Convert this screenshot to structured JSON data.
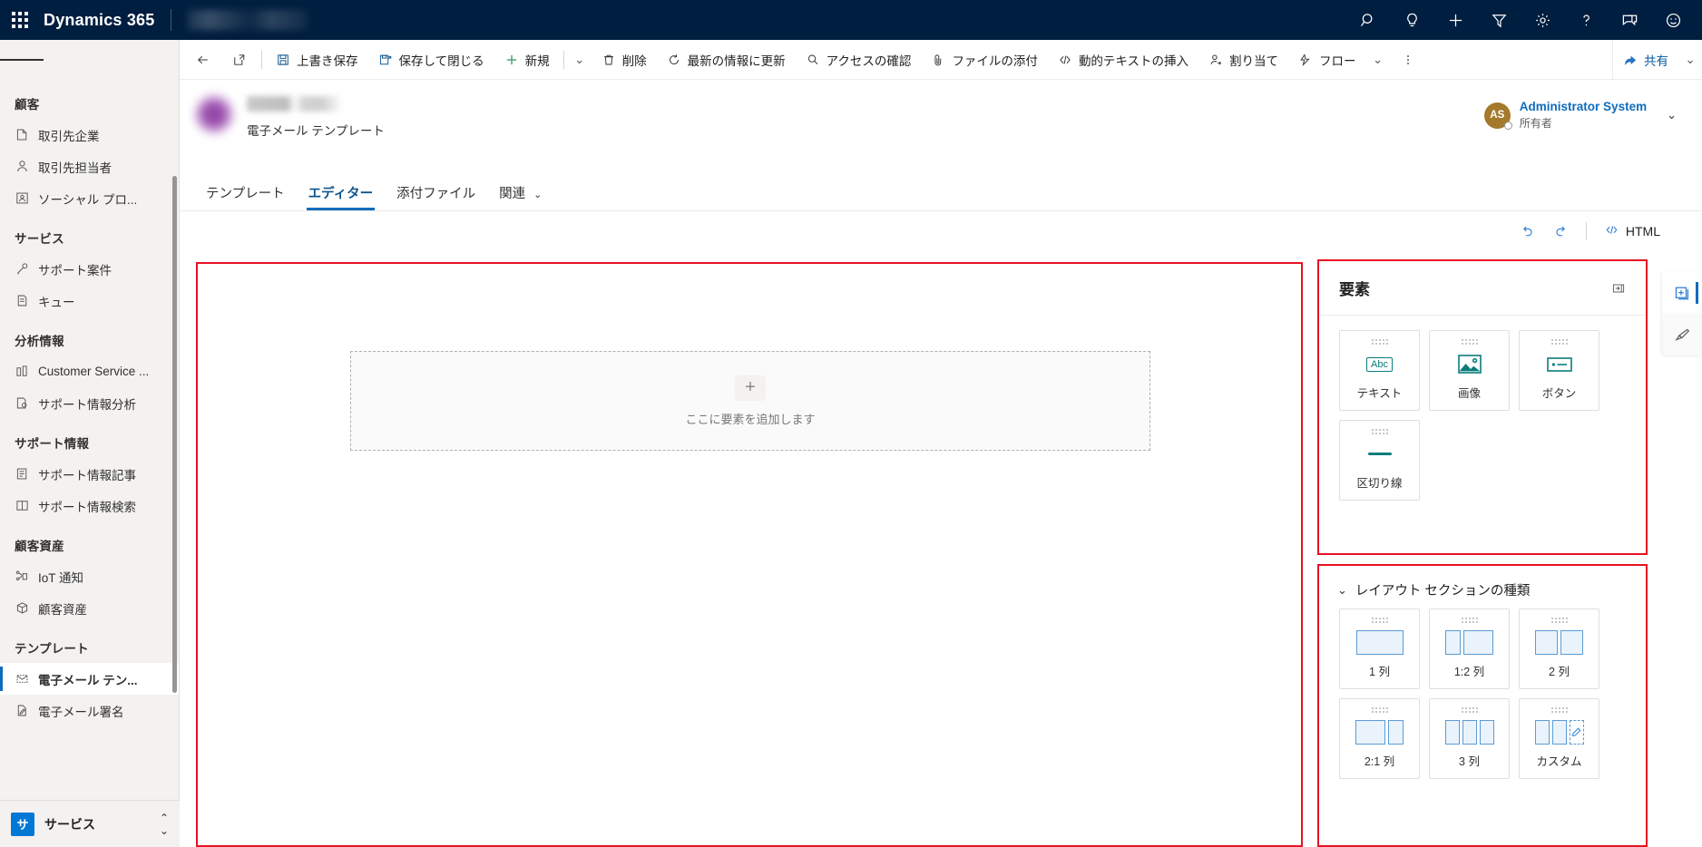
{
  "topbar": {
    "waffle": "app-launcher",
    "brand": "Dynamics 365",
    "app_name_blurred": "",
    "icons": [
      "search-icon",
      "lightbulb-icon",
      "plus-icon",
      "filter-icon",
      "gear-icon",
      "question-icon",
      "chat-icon",
      "smiley-icon"
    ]
  },
  "sidebar": {
    "groups": [
      {
        "title": "顧客",
        "items": [
          {
            "label": "取引先企業",
            "icon": "accounts-icon",
            "selected": false
          },
          {
            "label": "取引先担当者",
            "icon": "contacts-icon",
            "selected": false
          },
          {
            "label": "ソーシャル プロ...",
            "icon": "social-profile-icon",
            "selected": false
          }
        ]
      },
      {
        "title": "サービス",
        "items": [
          {
            "label": "サポート案件",
            "icon": "case-icon",
            "selected": false
          },
          {
            "label": "キュー",
            "icon": "queue-icon",
            "selected": false
          }
        ]
      },
      {
        "title": "分析情報",
        "items": [
          {
            "label": "Customer Service ...",
            "icon": "chart-icon",
            "selected": false
          },
          {
            "label": "サポート情報分析",
            "icon": "knowledge-analytics-icon",
            "selected": false
          }
        ]
      },
      {
        "title": "サポート情報",
        "items": [
          {
            "label": "サポート情報記事",
            "icon": "article-icon",
            "selected": false
          },
          {
            "label": "サポート情報検索",
            "icon": "book-icon",
            "selected": false
          }
        ]
      },
      {
        "title": "顧客資産",
        "items": [
          {
            "label": "IoT 通知",
            "icon": "iot-alert-icon",
            "selected": false
          },
          {
            "label": "顧客資産",
            "icon": "customer-asset-icon",
            "selected": false
          }
        ]
      },
      {
        "title": "テンプレート",
        "items": [
          {
            "label": "電子メール テン...",
            "icon": "email-template-icon",
            "selected": true
          },
          {
            "label": "電子メール署名",
            "icon": "email-signature-icon",
            "selected": false
          }
        ]
      }
    ],
    "area_switcher": {
      "badge": "サ",
      "label": "サービス",
      "chevron": "updown-chevron-icon"
    }
  },
  "commandbar": {
    "back": "back-arrow-icon",
    "popout": "popout-icon",
    "buttons": [
      {
        "label": "上書き保存",
        "icon": "save-icon"
      },
      {
        "label": "保存して閉じる",
        "icon": "save-close-icon"
      },
      {
        "label": "新規",
        "icon": "plus-icon"
      },
      {
        "label": "削除",
        "icon": "trash-icon"
      },
      {
        "label": "最新の情報に更新",
        "icon": "refresh-icon"
      },
      {
        "label": "アクセスの確認",
        "icon": "check-access-icon"
      },
      {
        "label": "ファイルの添付",
        "icon": "paperclip-icon"
      },
      {
        "label": "動的テキストの挿入",
        "icon": "code-icon"
      },
      {
        "label": "割り当て",
        "icon": "assign-user-icon"
      },
      {
        "label": "フロー",
        "icon": "flow-icon"
      }
    ],
    "overflow": "more-options-icon",
    "share_label": "共有",
    "share_icon": "share-icon"
  },
  "record": {
    "title_blurred": "",
    "subtitle": "電子メール テンプレート",
    "owner": {
      "initials": "AS",
      "name": "Administrator System",
      "role": "所有者",
      "chevron": "chevron-down-icon"
    },
    "tabs": [
      {
        "label": "テンプレート",
        "active": false
      },
      {
        "label": "エディター",
        "active": true
      },
      {
        "label": "添付ファイル",
        "active": false
      },
      {
        "label": "関連",
        "active": false,
        "has_chevron": true
      }
    ]
  },
  "editor_toolbar": {
    "undo": "undo-icon",
    "redo": "redo-icon",
    "html_label": "HTML",
    "html_icon": "code-brackets-icon"
  },
  "canvas": {
    "dropzone": {
      "plus": "+",
      "text": "ここに要素を追加します"
    }
  },
  "elements_panel": {
    "title": "要素",
    "collapse_icon": "collapse-panel-icon",
    "cards": [
      {
        "label": "テキスト",
        "art": "abc",
        "art_text": "Abc"
      },
      {
        "label": "画像",
        "art": "image"
      },
      {
        "label": "ボタン",
        "art": "button"
      },
      {
        "label": "区切り線",
        "art": "divider"
      }
    ]
  },
  "layouts_panel": {
    "title": "レイアウト セクションの種類",
    "chevron": "chevron-down-icon",
    "cards": [
      {
        "label": "1 列",
        "art": "one"
      },
      {
        "label": "1:2 列",
        "art": "one-two"
      },
      {
        "label": "2 列",
        "art": "two"
      },
      {
        "label": "2:1 列",
        "art": "two-one"
      },
      {
        "label": "3 列",
        "art": "three"
      },
      {
        "label": "カスタム",
        "art": "custom"
      }
    ]
  },
  "rail": {
    "buttons": [
      {
        "icon": "add-element-icon",
        "active": true
      },
      {
        "icon": "brush-icon",
        "active": false
      }
    ]
  },
  "colors": {
    "topbar_bg": "#001e3f",
    "accent_blue": "#0f6cbd",
    "highlight_red": "#e81123",
    "element_teal": "#0b7c7c",
    "layout_blue": "#5b9bd5"
  }
}
